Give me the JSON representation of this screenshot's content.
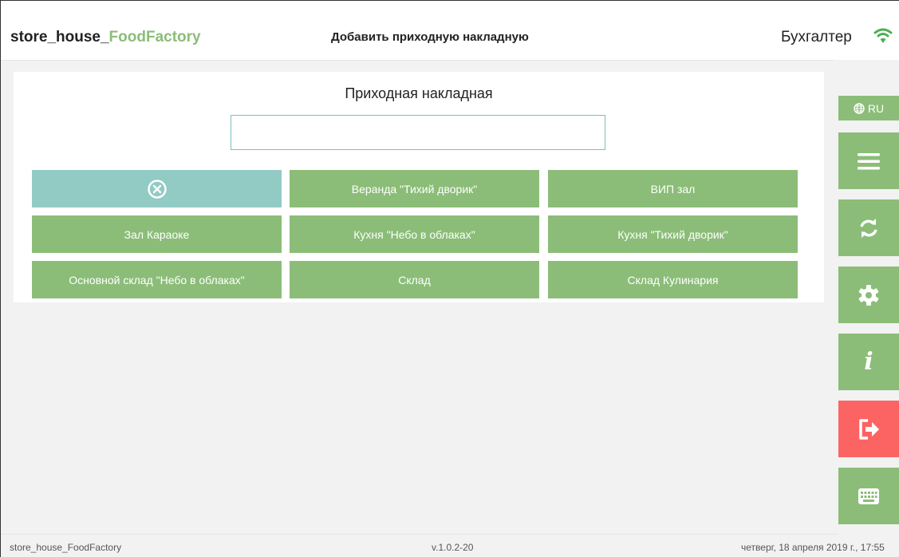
{
  "header": {
    "brand_prefix": "store_house_",
    "brand_accent": "FoodFactory",
    "screen_title": "Добавить приходную накладную",
    "user_role": "Бухгалтер",
    "wifi_icon": "wifi-icon"
  },
  "form": {
    "title": "Приходная накладная",
    "input_value": "",
    "input_placeholder": "",
    "clear_icon": "clear-circle-x-icon",
    "warehouses": [
      "Веранда \"Тихий дворик\"",
      "ВИП зал",
      "Зал Караоке",
      "Кухня \"Небо в облаках\"",
      "Кухня \"Тихий дворик\"",
      "Основной склад \"Небо в облаках\"",
      "Склад",
      "Склад Кулинария"
    ]
  },
  "sidebar": {
    "language": "RU",
    "icons": [
      "menu-icon",
      "sync-icon",
      "settings-icon",
      "info-icon",
      "logout-icon",
      "keyboard-icon"
    ]
  },
  "footer": {
    "app_name": "store_house_FoodFactory",
    "version": "v.1.0.2-20",
    "datetime": "четверг, 18 апреля 2019 г., 17:55"
  },
  "colors": {
    "accent_green": "#8bbd78",
    "clear_teal": "#92cac4",
    "logout_red": "#fc6464",
    "input_border": "#78c2b9"
  }
}
